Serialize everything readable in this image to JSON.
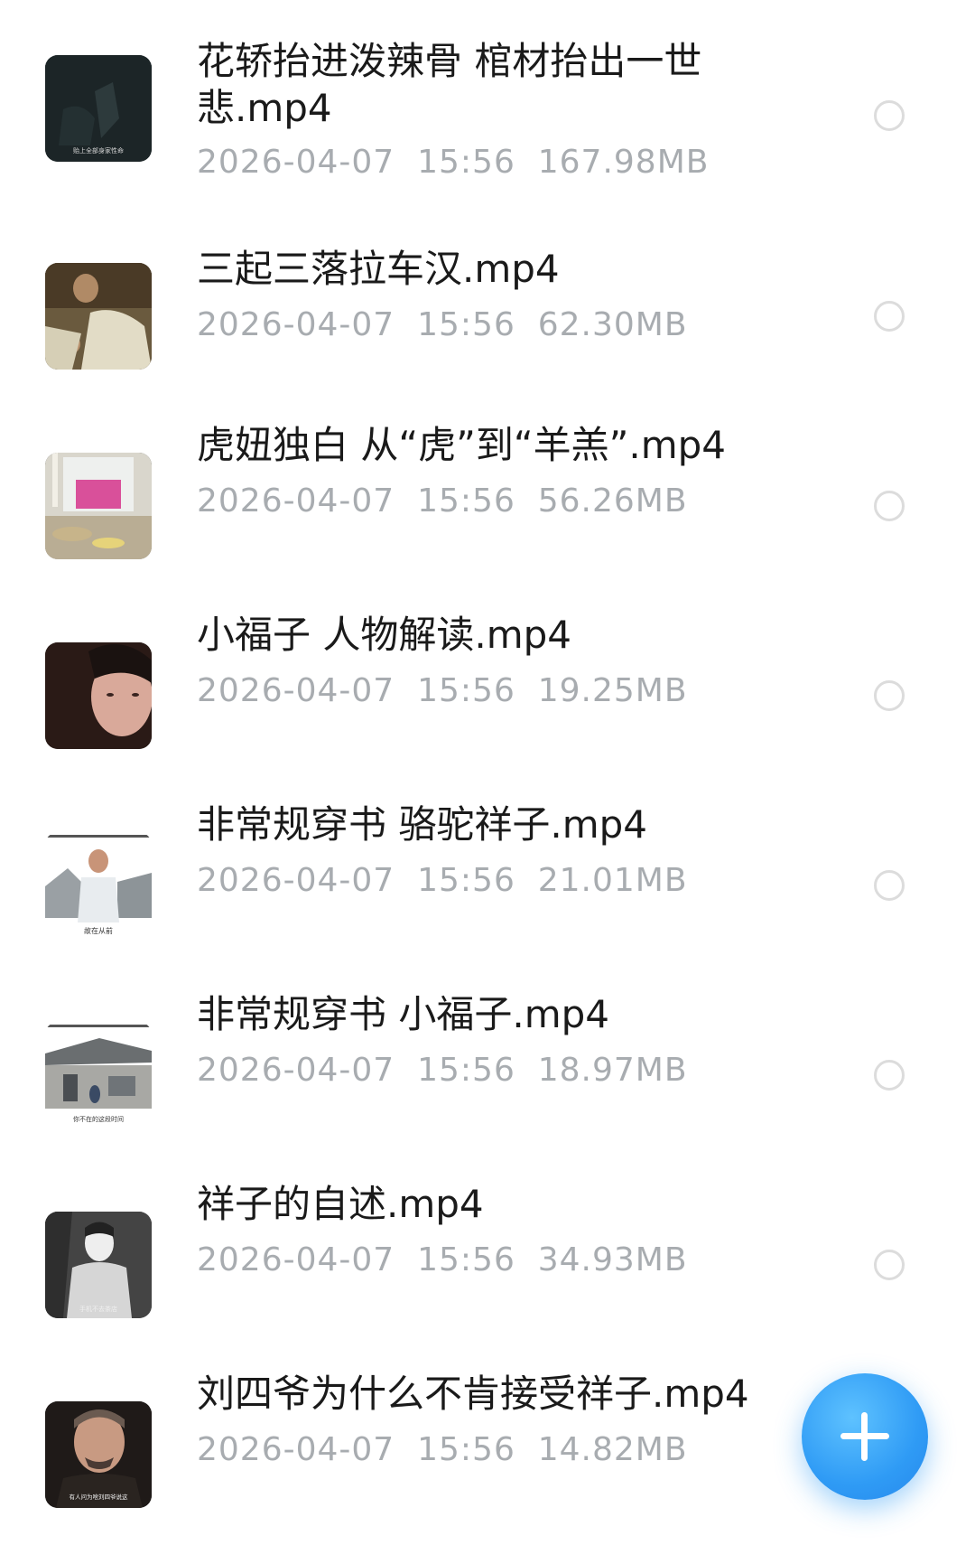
{
  "files": [
    {
      "name": "花轿抬进泼辣骨 棺材抬出一世悲.mp4",
      "date": "2026-04-07",
      "time": "15:56",
      "size": "167.98MB",
      "thumb_caption": "贻上全部身家性命"
    },
    {
      "name": "三起三落拉车汉.mp4",
      "date": "2026-04-07",
      "time": "15:56",
      "size": "62.30MB",
      "thumb_caption": ""
    },
    {
      "name": "虎妞独白 从“虎”到“羊羔”.mp4",
      "date": "2026-04-07",
      "time": "15:56",
      "size": "56.26MB",
      "thumb_caption": ""
    },
    {
      "name": "小福子 人物解读.mp4",
      "date": "2026-04-07",
      "time": "15:56",
      "size": "19.25MB",
      "thumb_caption": ""
    },
    {
      "name": "非常规穿书 骆驼祥子.mp4",
      "date": "2026-04-07",
      "time": "15:56",
      "size": "21.01MB",
      "thumb_caption": "故在从前"
    },
    {
      "name": "非常规穿书 小福子.mp4",
      "date": "2026-04-07",
      "time": "15:56",
      "size": "18.97MB",
      "thumb_caption": "你不在的这段时间"
    },
    {
      "name": "祥子的自述.mp4",
      "date": "2026-04-07",
      "time": "15:56",
      "size": "34.93MB",
      "thumb_caption": "手机不去茶店"
    },
    {
      "name": "刘四爷为什么不肯接受祥子.mp4",
      "date": "2026-04-07",
      "time": "15:56",
      "size": "14.82MB",
      "thumb_caption": "有人问为啥刘四爷说这"
    }
  ],
  "fab": {
    "icon": "plus-icon",
    "color": "#2f9bf5"
  },
  "colors": {
    "title": "#1a1a1a",
    "meta": "#a8acb0",
    "radio": "#dcdcdc"
  }
}
